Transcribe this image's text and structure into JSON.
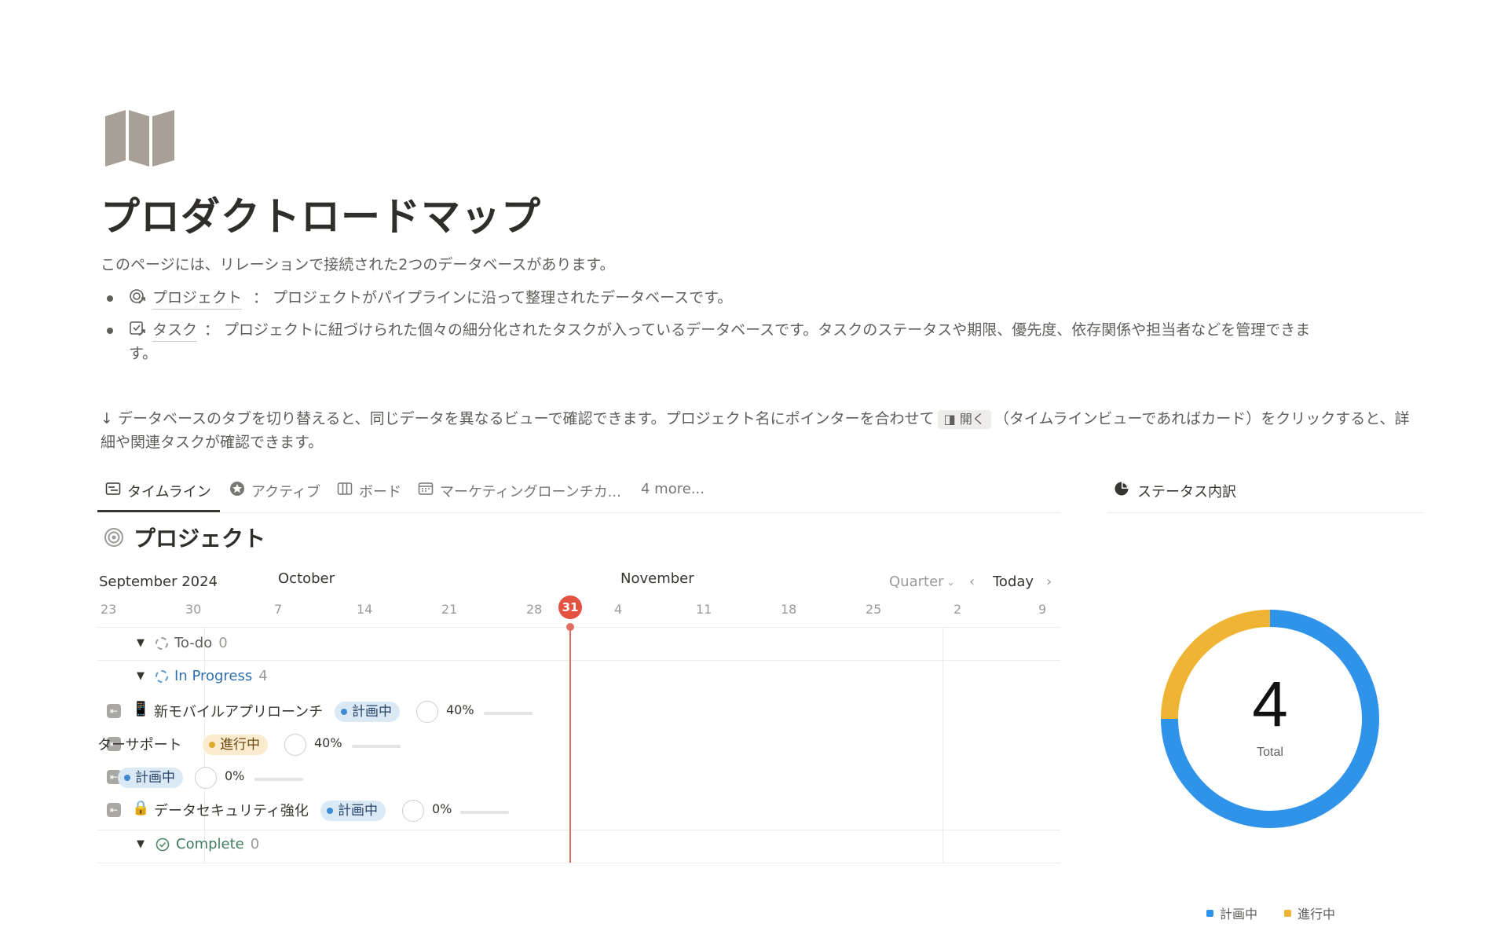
{
  "page": {
    "title": "プロダクトロードマップ",
    "description": "このページには、リレーションで接続された2つのデータベースがあります。",
    "bullets": [
      {
        "link": "プロジェクト",
        "text": "： プロジェクトがパイプラインに沿って整理されたデータベースです。"
      },
      {
        "link": "タスク",
        "text": "： プロジェクトに紐づけられた個々の細分化されたタスクが入っているデータベースです。タスクのステータスや期限、優先度、依存関係や担当者などを管理できま",
        "text_cont": "す。"
      }
    ],
    "note_before": "↓ データベースのタブを切り替えると、同じデータを異なるビューで確認できます。プロジェクト名にポインターを合わせて",
    "note_button": "◨ 開く",
    "note_after": "（タイムラインビューであればカード）をクリックすると、詳細や関連タスクが確認できます。"
  },
  "tabs": [
    {
      "label": "タイムライン",
      "icon": "timeline-icon",
      "active": true
    },
    {
      "label": "アクティブ",
      "icon": "star-icon",
      "active": false
    },
    {
      "label": "ボード",
      "icon": "board-icon",
      "active": false
    },
    {
      "label": "マーケティングローンチカ...",
      "icon": "calendar-icon",
      "active": false
    },
    {
      "label": "4 more...",
      "icon": "",
      "active": false
    }
  ],
  "status_widget": {
    "title": "ステータス内訳",
    "total": "4",
    "total_label": "Total"
  },
  "database": {
    "title": "プロジェクト"
  },
  "timeline": {
    "months": [
      "September 2024",
      "October",
      "November"
    ],
    "days": [
      "23",
      "30",
      "7",
      "14",
      "21",
      "28",
      "4",
      "11",
      "18",
      "25",
      "2",
      "9"
    ],
    "today_day": "31",
    "range": "Quarter",
    "today_label": "Today",
    "groups": [
      {
        "label": "To-do",
        "count": "0"
      },
      {
        "label": "In Progress",
        "count": "4"
      },
      {
        "label": "Complete",
        "count": "0"
      }
    ],
    "rows": [
      {
        "emoji": "📱",
        "name": "新モバイルアプリローンチ",
        "status": "計画中",
        "progress_text": "40%",
        "progress": 0.4
      },
      {
        "emoji": "",
        "name": "ターサポート",
        "status": "進行中",
        "progress_text": "40%",
        "progress": 0.4
      },
      {
        "emoji": "",
        "name": "",
        "status": "計画中",
        "progress_text": "0%",
        "progress": 0
      },
      {
        "emoji": "🔒",
        "name": "データセキュリティ強化",
        "status": "計画中",
        "progress_text": "0%",
        "progress": 0
      }
    ]
  },
  "chart_data": {
    "type": "pie",
    "categories": [
      "計画中",
      "進行中"
    ],
    "values": [
      3,
      1
    ],
    "colors": [
      "#2f93ea",
      "#efb434"
    ],
    "title": "ステータス内訳",
    "center_value": "4",
    "center_label": "Total",
    "legend": "bottom"
  },
  "colors": {
    "accent_today": "#e45341",
    "plan": "#3d8bd3",
    "progress": "#dfab2d"
  }
}
